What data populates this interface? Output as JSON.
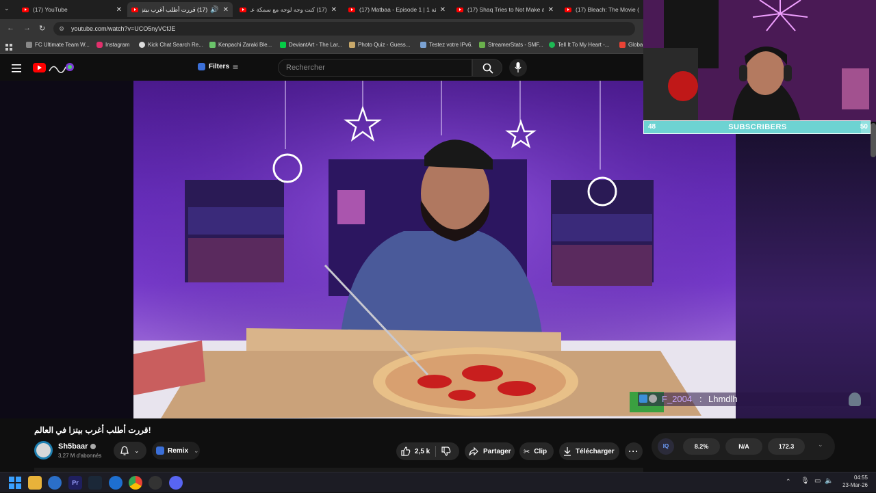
{
  "tabs": [
    {
      "title": "(17) YouTube",
      "active": false
    },
    {
      "title": "(17) قررت أطلب أغرب بيتزا في العالم",
      "active": true
    },
    {
      "title": "(17) كنت وجه لوجه مع سمكة عملاقة",
      "active": false
    },
    {
      "title": "(17) Matbaa - Episode 1 | 1 الحلقة",
      "active": false
    },
    {
      "title": "(17) Shaq Tries to Not Make a F",
      "active": false
    },
    {
      "title": "(17) Bleach: The Movie (2025",
      "active": false
    }
  ],
  "address": {
    "url": "youtube.com/watch?v=UCO5nyVCfJE"
  },
  "bookmarks": [
    "FC Ultimate Team W...",
    "Instagram",
    "Kick Chat Search Re...",
    "Kenpachi Zaraki Ble...",
    "DeviantArt - The Lar...",
    "Photo Quiz - Guess...",
    "Testez votre IPv6.",
    "StreamerStats - SMF...",
    "Tell It To My Heart -...",
    "Globa"
  ],
  "bookmark_colors": [
    "#888888",
    "#e1306c",
    "#dddddd",
    "#6ac36a",
    "#05cc47",
    "#c8a86a",
    "#7aa1d2",
    "#6ab04c",
    "#1db954",
    "#ea4335"
  ],
  "youtube_header": {
    "filters_label": "Filters",
    "search_placeholder": "Rechercher"
  },
  "video": {
    "title": "!قررت أطلب أغرب بيتزا في العالم",
    "channel": {
      "name": "Sh5baar",
      "subscribers": "3,27 M d'abonnés"
    },
    "remix_label": "Remix",
    "likes": "2,5 k",
    "share_label": "Partager",
    "clip_label": "Clip",
    "download_label": "Télécharger"
  },
  "stream_overlay": {
    "subscribers_current": "48",
    "subscribers_label": "SUBSCRIBERS",
    "subscribers_goal": "50",
    "subscribers_progress": 0.96,
    "chat_user": "F_2004",
    "chat_separator": ":",
    "chat_message": "Lhmdlh"
  },
  "extension": {
    "badge": "IQ",
    "stat1": "8.2%",
    "stat2": "N/A",
    "stat3": "172.3"
  },
  "system_tray": {
    "time": "04:55",
    "date": "23-Mar-26"
  },
  "colors": {
    "youtube_red": "#ff0000",
    "accent_teal": "#8fe0df",
    "extension_blue": "#3b6fd8"
  }
}
